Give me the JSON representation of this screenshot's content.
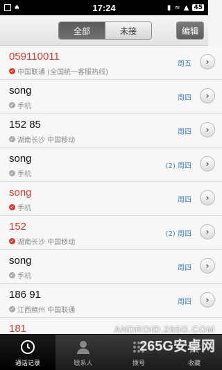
{
  "status_bar": {
    "time": "17:24",
    "battery": "45"
  },
  "header": {
    "segments": [
      {
        "label": "全部",
        "active": true
      },
      {
        "label": "未接",
        "active": false
      }
    ],
    "edit_label": "编辑"
  },
  "calls": [
    {
      "name": "059110011",
      "missed": true,
      "type": "missed",
      "detail": "中国联通 (全国统一客服热线)",
      "time": "周五",
      "blurred": false
    },
    {
      "name": "song",
      "missed": false,
      "type": "incoming",
      "detail": "手机",
      "time": "周四",
      "blurred": false
    },
    {
      "name": "152        85",
      "missed": false,
      "type": "incoming",
      "detail": "湖南长沙  中国移动",
      "time": "周四",
      "blurred": true
    },
    {
      "name": "song",
      "missed": false,
      "type": "incoming",
      "detail": "手机",
      "time": "(2) 周四",
      "blurred": false
    },
    {
      "name": "song",
      "missed": true,
      "type": "missed",
      "detail": "手机",
      "time": "周四",
      "blurred": false
    },
    {
      "name": "152",
      "missed": true,
      "type": "missed",
      "detail": "湖南长沙  中国移动",
      "time": "(2) 周四",
      "blurred": true
    },
    {
      "name": "song",
      "missed": false,
      "type": "incoming",
      "detail": "手机",
      "time": "周四",
      "blurred": false
    },
    {
      "name": "186        91",
      "missed": false,
      "type": "incoming",
      "detail": "江西赣州  中国联通",
      "time": "周四",
      "blurred": true
    },
    {
      "name": "181",
      "missed": true,
      "type": "missed",
      "detail": "",
      "time": "",
      "blurred": true
    }
  ],
  "tabbar": {
    "tabs": [
      {
        "label": "通话记录",
        "icon": "clock-icon",
        "active": true
      },
      {
        "label": "联系人",
        "icon": "person-icon",
        "active": false
      },
      {
        "label": "拨号",
        "icon": "dialpad-icon",
        "active": false
      },
      {
        "label": "收藏",
        "icon": "star-icon",
        "active": false
      }
    ]
  },
  "watermark": {
    "line1": "ANDROID.265G.COM",
    "line2": "265G安卓网"
  },
  "colors": {
    "missed": "#d23a2e",
    "time": "#3e7fc1",
    "active_segment": "#5a5a5a"
  }
}
